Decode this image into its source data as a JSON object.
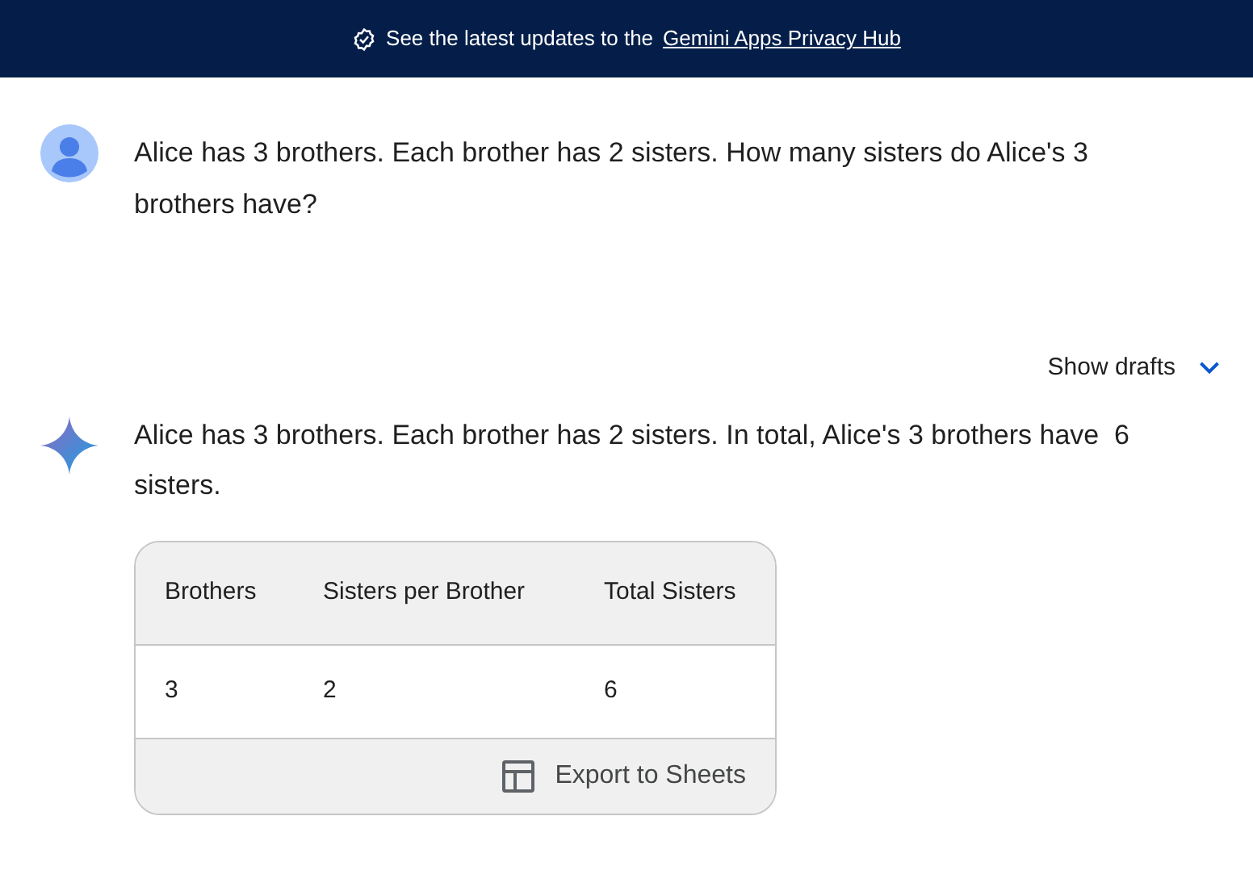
{
  "banner": {
    "text": "See the latest updates to the",
    "link": "Gemini Apps Privacy Hub"
  },
  "prompt": {
    "text": "Alice has 3 brothers. Each brother has 2 sisters. How many sisters do Alice's 3 brothers have?"
  },
  "show_drafts": {
    "label": "Show drafts",
    "expanded": false
  },
  "response": {
    "text": "Alice has 3 brothers. Each brother has 2 sisters. In total, Alice's 3 brothers have  6 sisters.",
    "table": {
      "columns": [
        "Brothers",
        "Sisters per Brother",
        "Total Sisters"
      ],
      "rows": [
        [
          "3",
          "2",
          "6"
        ]
      ],
      "export": "Export to Sheets"
    }
  }
}
